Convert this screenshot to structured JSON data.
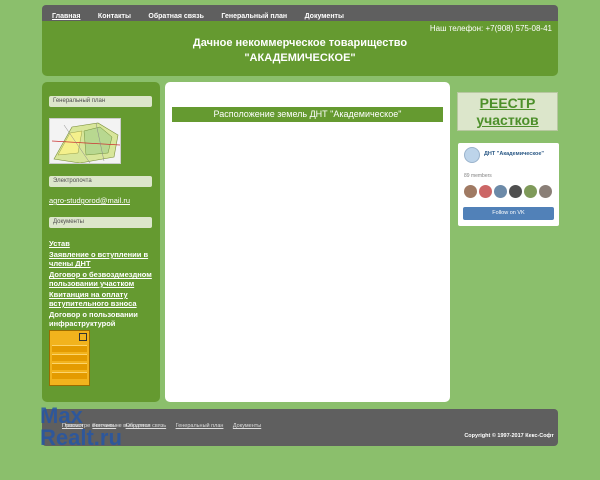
{
  "nav": {
    "items": [
      "Главная",
      "Контакты",
      "Обратная связь",
      "Генеральный план",
      "Документы"
    ]
  },
  "header": {
    "phone": "Наш телефон: +7(908) 575-08-41",
    "title_line1": "Дачное некоммерческое товарищество",
    "title_line2": "\"АКАДЕМИЧЕСКОЕ\""
  },
  "sidebar": {
    "plan_heading": "Генеральный план",
    "email_heading": "Электропочта",
    "email": "agro-studgorod@mail.ru",
    "docs_heading": "Документы",
    "docs": [
      "Устав",
      "Заявление о вступлении в члены ДНТ",
      "Договор о безвоздмездном пользовании участком",
      "Квитанция на оплату вступительного взноса",
      "Договор о пользовании инфраструктурой"
    ]
  },
  "main": {
    "title": "Расположение земель ДНТ \"Академическое\""
  },
  "registry": {
    "line1": "РЕЕСТР",
    "line2": "участков"
  },
  "vk": {
    "name": "ДНТ \"Академическое\"",
    "members": "89 members",
    "follow": "Follow on VK"
  },
  "footer": {
    "links": [
      "Главная",
      "Контакты",
      "Обратная связь",
      "Генеральный план",
      "Документы"
    ],
    "note": "Просмотре счетчики не выводятся",
    "copyright": "Copyright © 1997-2017 Кекс-Софт"
  },
  "watermark": {
    "line1": "Max",
    "line2": "Realt.ru"
  },
  "colors": {
    "background": "#8bbf6c",
    "green": "#659a30",
    "nav": "#5f5f5f",
    "vk_button": "#5181b8"
  }
}
